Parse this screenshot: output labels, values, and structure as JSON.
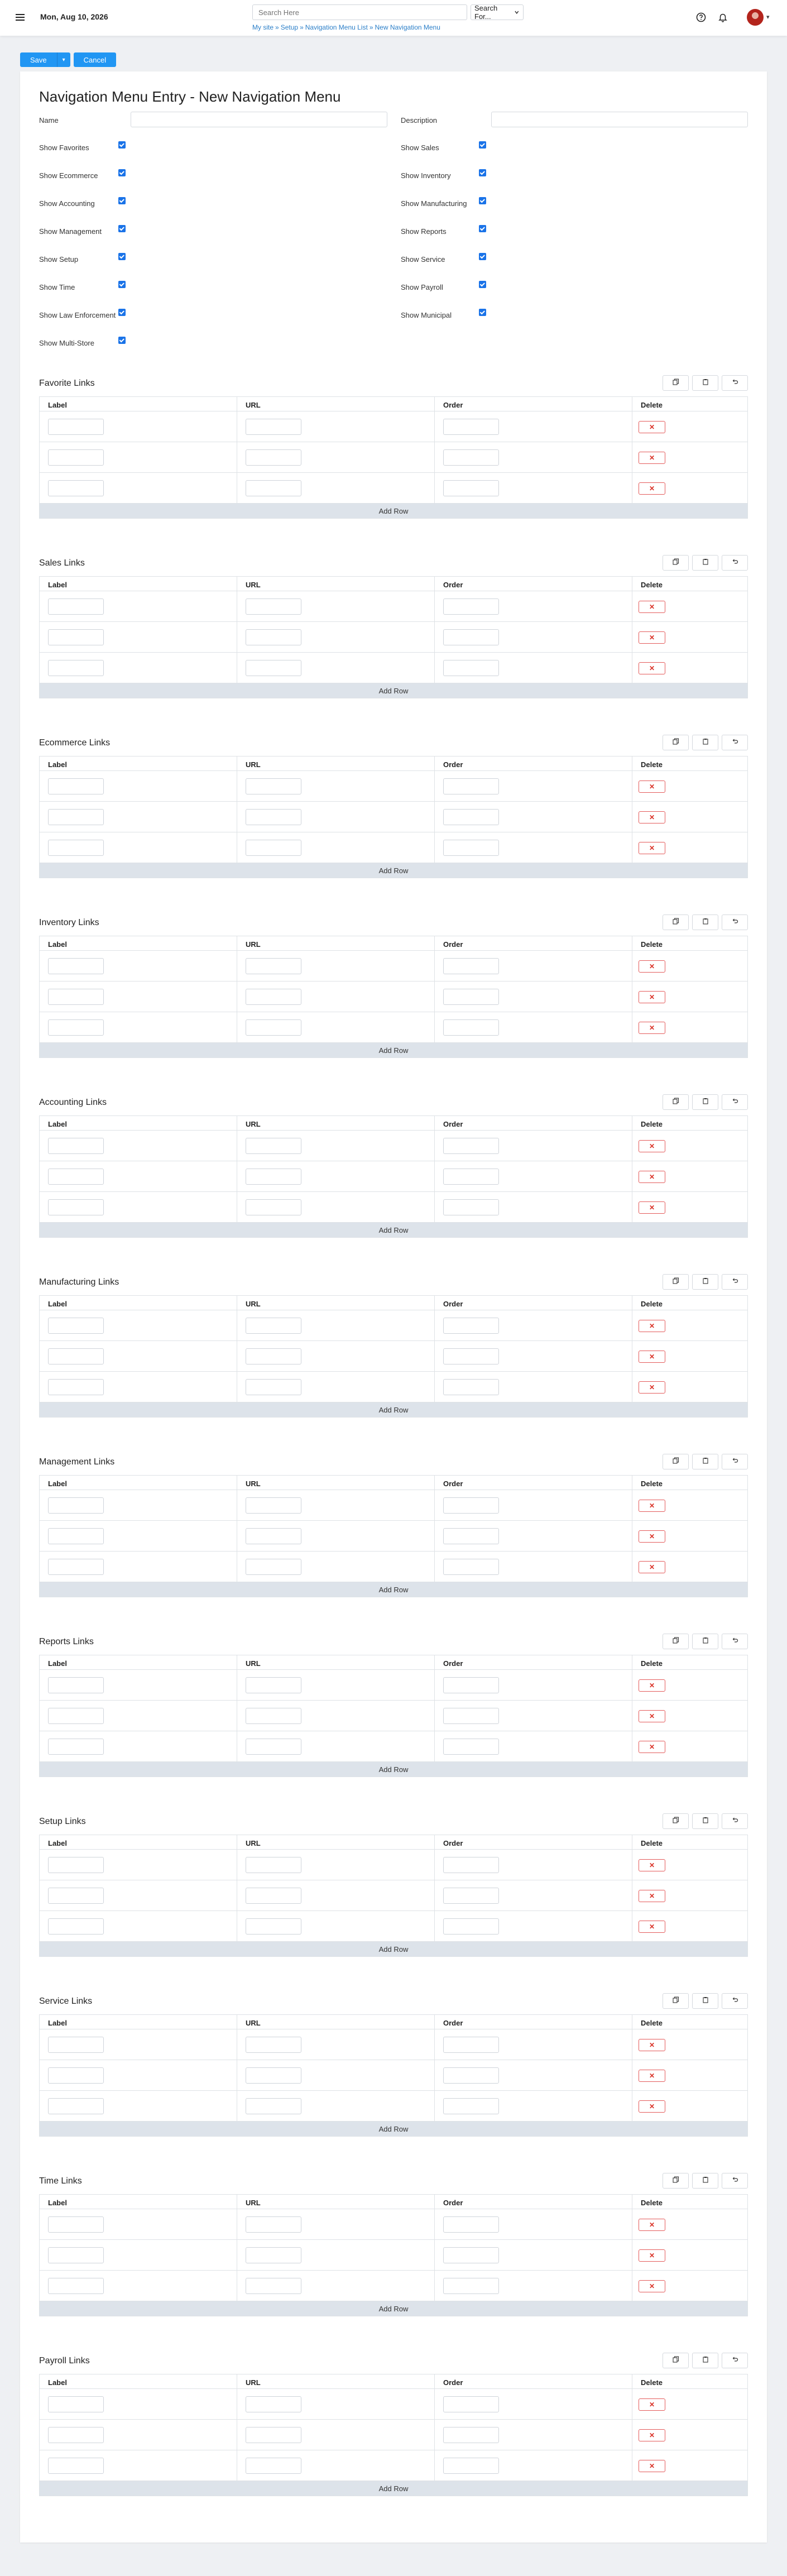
{
  "header": {
    "date": "Mon, Aug 10, 2026",
    "search_placeholder": "Search Here",
    "search_for": "Search For...",
    "breadcrumb": [
      "My site",
      "Setup",
      "Navigation Menu List",
      "New Navigation Menu"
    ]
  },
  "actions": {
    "save": "Save",
    "cancel": "Cancel"
  },
  "page": {
    "title": "Navigation Menu Entry - New Navigation Menu"
  },
  "fields": {
    "name_label": "Name",
    "description_label": "Description"
  },
  "checkboxes_left": [
    "Show Favorites",
    "Show Ecommerce",
    "Show Accounting",
    "Show Management",
    "Show Setup",
    "Show Time",
    "Show Law Enforcement",
    "Show Multi-Store"
  ],
  "checkboxes_right": [
    "Show Sales",
    "Show Inventory",
    "Show Manufacturing",
    "Show Reports",
    "Show Service",
    "Show Payroll",
    "Show Municipal"
  ],
  "grid_columns": {
    "label": "Label",
    "url": "URL",
    "order": "Order",
    "delete": "Delete"
  },
  "add_row": "Add Row",
  "sections": [
    "Favorite Links",
    "Sales Links",
    "Ecommerce Links",
    "Inventory Links",
    "Accounting Links",
    "Manufacturing Links",
    "Management Links",
    "Reports Links",
    "Setup Links",
    "Service Links",
    "Time Links",
    "Payroll Links"
  ],
  "icons": {
    "menu": "hamburger-icon",
    "help": "help-circle-icon",
    "bell": "bell-icon",
    "copy": "copy-icon",
    "paste": "clipboard-icon",
    "undo": "undo-icon",
    "delete": "close-icon"
  },
  "colors": {
    "primary": "#2196f3",
    "danger": "#d93025",
    "link": "#2a7ec8"
  }
}
